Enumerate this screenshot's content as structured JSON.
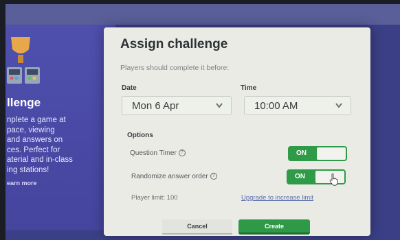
{
  "side_panel": {
    "heading": "llenge",
    "description_lines": [
      "nplete a game at",
      "pace, viewing",
      "and answers on",
      "ces. Perfect for",
      "aterial and in-class",
      "ing stations!"
    ],
    "learn_more": "earn more"
  },
  "modal": {
    "title": "Assign challenge",
    "subtitle": "Players should complete it before:",
    "date": {
      "label": "Date",
      "value": "Mon 6 Apr"
    },
    "time": {
      "label": "Time",
      "value": "10:00 AM"
    },
    "options_label": "Options",
    "question_timer": {
      "label": "Question Timer",
      "state": "ON"
    },
    "randomize": {
      "label": "Randomize answer order",
      "state": "ON"
    },
    "player_limit": "Player limit: 100",
    "upgrade_link": "Upgrade to increase limit",
    "cancel_label": "Cancel",
    "create_label": "Create"
  },
  "colors": {
    "accent_green": "#2f9b48",
    "panel_purple": "#4f4fae",
    "modal_bg": "#e9ebe4"
  }
}
